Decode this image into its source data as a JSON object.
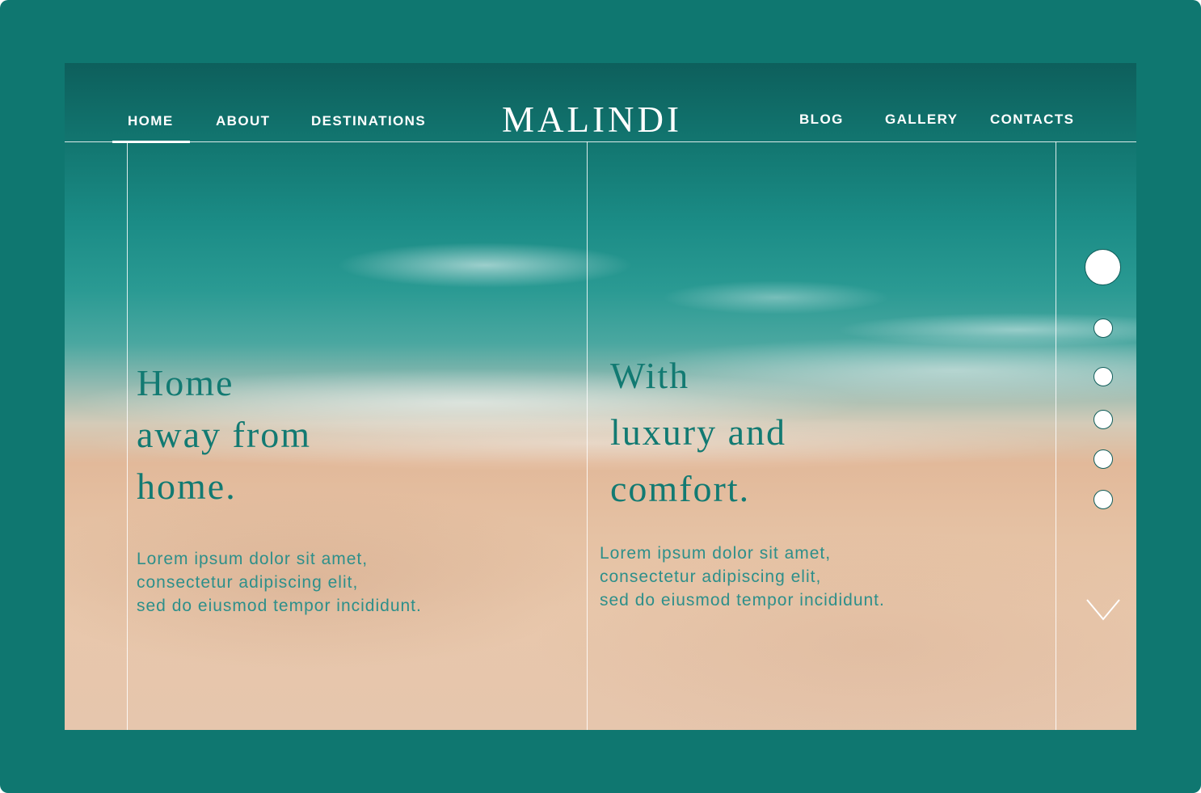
{
  "nav": {
    "left": [
      "HOME",
      "ABOUT",
      "DESTINATIONS"
    ],
    "right": [
      "BLOG",
      "GALLERY",
      "CONTACTS"
    ],
    "active": "HOME"
  },
  "logo": "MALINDI",
  "hero": {
    "left": {
      "headline": [
        "Home",
        "away from",
        "home."
      ],
      "body": [
        "Lorem ipsum dolor sit amet,",
        "consectetur adipiscing elit,",
        "sed do eiusmod tempor incididunt."
      ]
    },
    "right": {
      "headline": [
        "With",
        "luxury and",
        "comfort."
      ],
      "body": [
        "Lorem ipsum dolor sit amet,",
        "consectetur adipiscing elit,",
        "sed do eiusmod tempor incididunt."
      ]
    }
  },
  "slider": {
    "slide_count": 6,
    "active_slide": 1
  },
  "icons": {
    "scroll_down": "chevron-down-icon"
  },
  "colors": {
    "frame": "#0f7770",
    "headline": "#127a72",
    "body_text": "#2d8f8a",
    "nav_text": "#ffffff"
  }
}
